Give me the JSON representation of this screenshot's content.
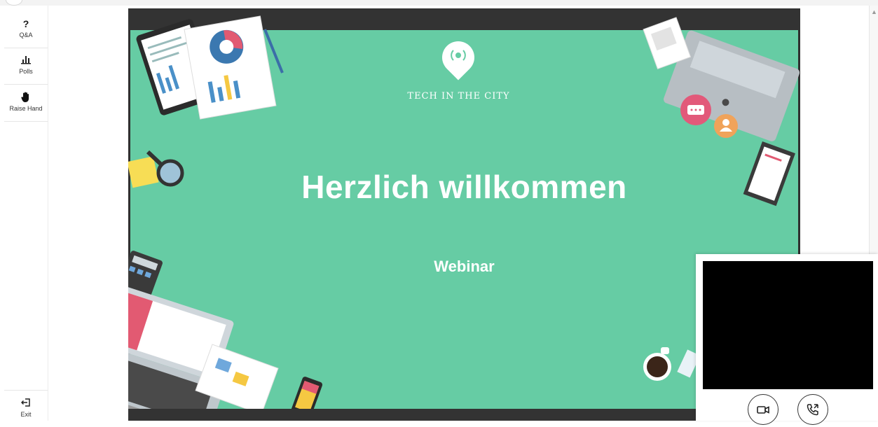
{
  "sidebar": {
    "items": [
      {
        "label": "Q&A",
        "icon": "question-icon",
        "glyph": "?"
      },
      {
        "label": "Polls",
        "icon": "bar-chart-icon",
        "glyph": "ılı"
      },
      {
        "label": "Raise Hand",
        "icon": "hand-icon",
        "glyph": "✋"
      }
    ],
    "exit": {
      "label": "Exit",
      "icon": "exit-icon",
      "glyph": "↤"
    }
  },
  "slide": {
    "logo_text": "TECH IN THE CITY",
    "title": "Herzlich willkommen",
    "subtitle": "Webinar",
    "background": "#66cca4"
  },
  "self_view": {
    "camera_icon": "camera-icon",
    "call_icon": "phone-call-icon"
  }
}
